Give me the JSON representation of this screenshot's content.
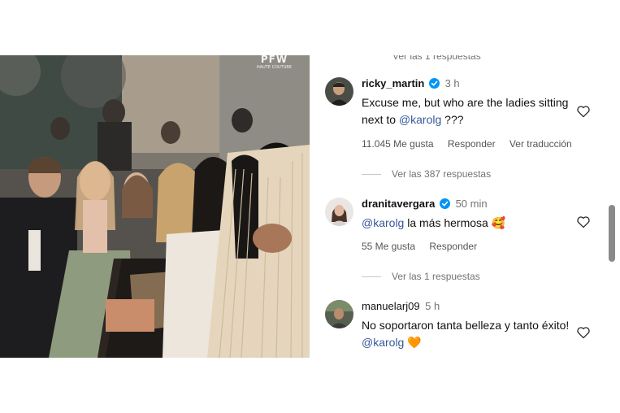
{
  "photo": {
    "watermark_main": "PFW",
    "watermark_sub": "HAUTE COUTURE"
  },
  "thread": {
    "top_replies_label": "Ver las 1 respuestas",
    "comments": [
      {
        "username": "ricky_martin",
        "verified": true,
        "time": "3 h",
        "text_before": "Excuse me, but who are the ladies sitting next to ",
        "mention": "@karolg",
        "text_after": " ???",
        "likes": "11.045 Me gusta",
        "reply_label": "Responder",
        "translate_label": "Ver traducción",
        "replies_label": "Ver las 387 respuestas"
      },
      {
        "username": "dranitavergara",
        "verified": true,
        "time": "50 min",
        "mention": "@karolg",
        "text_after": " la más hermosa ",
        "emoji": "🥰",
        "likes": "55 Me gusta",
        "reply_label": "Responder",
        "replies_label": "Ver las 1 respuestas"
      },
      {
        "username": "manuelarj09",
        "verified": false,
        "time": "5 h",
        "text_before": "No soportaron tanta belleza y tanto éxito! ",
        "mention": "@karolg",
        "emoji": "🧡"
      }
    ]
  },
  "colors": {
    "mention": "#385898",
    "verified": "#0095f6",
    "secondary_text": "#737373"
  }
}
